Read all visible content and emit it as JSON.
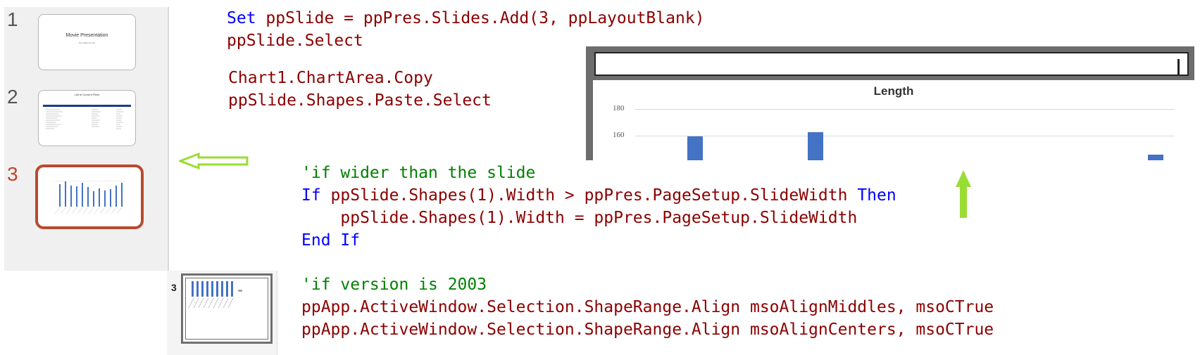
{
  "thumbnails": {
    "slides": [
      {
        "number": "1",
        "title": "Movie Presentation",
        "subtitle": "By Cadby Kemal"
      },
      {
        "number": "2",
        "title": "List of Current Films"
      },
      {
        "number": "3"
      }
    ]
  },
  "code_top": {
    "line1_kw": "Set",
    "line1_rest": " ppSlide = ppPres.Slides.Add(3, ppLayoutBlank)",
    "line2": "ppSlide.Select",
    "line3": "Chart1.ChartArea.Copy",
    "line4": "ppSlide.Shapes.Paste.Select"
  },
  "code_mid": {
    "comment": "'if wider than the slide",
    "if_kw": "If",
    "if_cond": " ppSlide.Shapes(1).Width > ppPres.PageSetup.SlideWidth ",
    "then_kw": "Then",
    "assign": "    ppSlide.Shapes(1).Width = ppPres.PageSetup.SlideWidth",
    "endif_kw": "End If"
  },
  "code_bottom": {
    "comment": "'if version is 2003",
    "line1": "ppApp.ActiveWindow.Selection.ShapeRange.Align msoAlignMiddles, msoCTrue",
    "line2": "ppApp.ActiveWindow.Selection.ShapeRange.Align msoAlignCenters, msoCTrue"
  },
  "chart_preview": {
    "title": "Length",
    "tick_180": "180",
    "tick_160": "160"
  },
  "old_thumb": {
    "number": "3"
  },
  "colors": {
    "arrow": "#99dd33",
    "keyword": "#0000ff",
    "identifier": "#8b0000",
    "comment": "#008000",
    "selected_border": "#b94a2f"
  }
}
